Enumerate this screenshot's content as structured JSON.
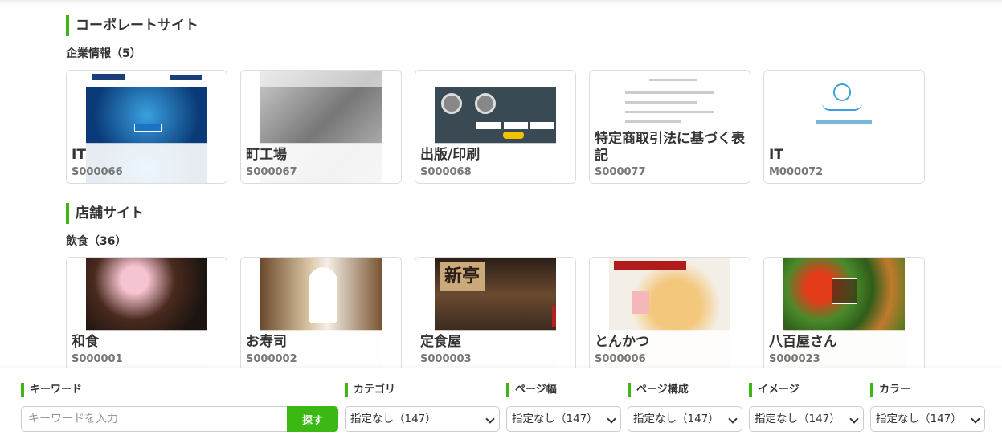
{
  "sections": [
    {
      "title": "コーポレートサイト",
      "subtitle": "企業情報（5）",
      "cards": [
        {
          "title": "IT",
          "code": "S000066"
        },
        {
          "title": "町工場",
          "code": "S000067"
        },
        {
          "title": "出版/印刷",
          "code": "S000068"
        },
        {
          "title": "特定商取引法に基づく表記",
          "code": "S000077"
        },
        {
          "title": "IT",
          "code": "M000072"
        }
      ]
    },
    {
      "title": "店舗サイト",
      "subtitle": "飲食（36）",
      "cards": [
        {
          "title": "和食",
          "code": "S000001"
        },
        {
          "title": "お寿司",
          "code": "S000002"
        },
        {
          "title": "定食屋",
          "code": "S000003"
        },
        {
          "title": "とんかつ",
          "code": "S000006"
        },
        {
          "title": "八百屋さん",
          "code": "S000023"
        }
      ]
    }
  ],
  "thumb_text": {
    "teishoku_sign": "新亭"
  },
  "filters": {
    "keyword": {
      "label": "キーワード",
      "placeholder": "キーワードを入力",
      "value": "",
      "button": "探す"
    },
    "category": {
      "label": "カテゴリ",
      "selected": "指定なし（147）"
    },
    "page_width": {
      "label": "ページ幅",
      "selected": "指定なし（147）"
    },
    "page_structure": {
      "label": "ページ構成",
      "selected": "指定なし（147）"
    },
    "image": {
      "label": "イメージ",
      "selected": "指定なし（147）"
    },
    "color": {
      "label": "カラー",
      "selected": "指定なし（147）"
    }
  },
  "accent_color": "#3cb815"
}
